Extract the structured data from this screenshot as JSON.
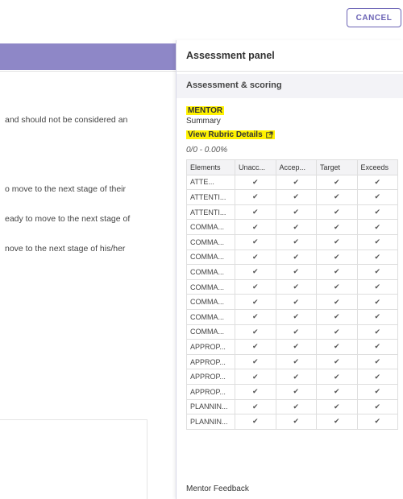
{
  "toolbar": {
    "cancel_label": "CANCEL"
  },
  "background": {
    "lines": [
      {
        "text": "and should not be considered an"
      },
      {
        "text": "o move to the next stage of their"
      },
      {
        "text": "eady to move to the next stage of"
      },
      {
        "text": "nove to the next stage of his/her"
      }
    ]
  },
  "panel": {
    "title": "Assessment panel",
    "section_title": "Assessment & scoring",
    "mentor_label": "MENTOR",
    "summary_label": "Summary",
    "rubric_link": "View Rubric Details",
    "score": "0/0 - 0.00%",
    "table": {
      "headers": [
        "Elements",
        "Unacc...",
        "Accep...",
        "Target",
        "Exceeds"
      ],
      "rows": [
        "ATTE...",
        "ATTENTI...",
        "ATTENTI...",
        "COMMA...",
        "COMMA...",
        "COMMA...",
        "COMMA...",
        "COMMA...",
        "COMMA...",
        "COMMA...",
        "COMMA...",
        "APPROP...",
        "APPROP...",
        "APPROP...",
        "APPROP...",
        "PLANNIN...",
        "PLANNIN..."
      ],
      "check_symbol": "✔"
    },
    "feedback_label": "Mentor Feedback"
  },
  "colors": {
    "accent": "#8e87c7",
    "button_border": "#6b63b5",
    "highlight": "#fff200"
  }
}
